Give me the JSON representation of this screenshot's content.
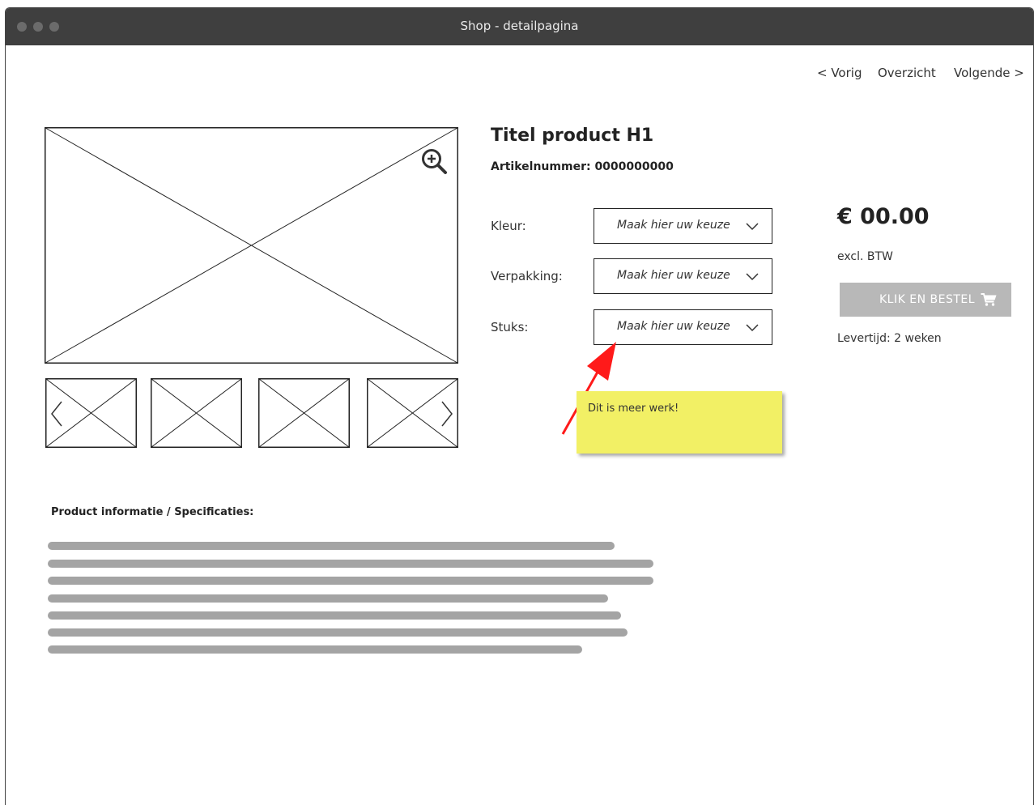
{
  "window": {
    "title": "Shop - detailpagina"
  },
  "nav": {
    "prev": "< Vorig",
    "overview": "Overzicht",
    "next": "Volgende >"
  },
  "product": {
    "title": "Titel product H1",
    "sku": "Artikelnummer: 0000000000",
    "price": "€ 00.00",
    "vat_note": "excl. BTW",
    "delivery": "Levertijd: 2 weken"
  },
  "options": [
    {
      "label": "Kleur:",
      "placeholder": "Maak hier uw keuze"
    },
    {
      "label": "Verpakking:",
      "placeholder": "Maak hier uw keuze"
    },
    {
      "label": "Stuks:",
      "placeholder": "Maak hier uw keuze"
    }
  ],
  "order_button": {
    "label": "KLIK EN BESTEL",
    "icon": "cart-icon"
  },
  "annotation": {
    "text": "Dit is meer werk!",
    "note_color": "#f2f065",
    "arrow_color": "#ff1a1a"
  },
  "specs": {
    "title": "Product informatie / Specificaties:",
    "placeholder_line_count": 7
  },
  "colors": {
    "titlebar": "#3f3f3f",
    "button_disabled": "#b8b8b8",
    "placeholder_text": "#a4a4a4"
  }
}
